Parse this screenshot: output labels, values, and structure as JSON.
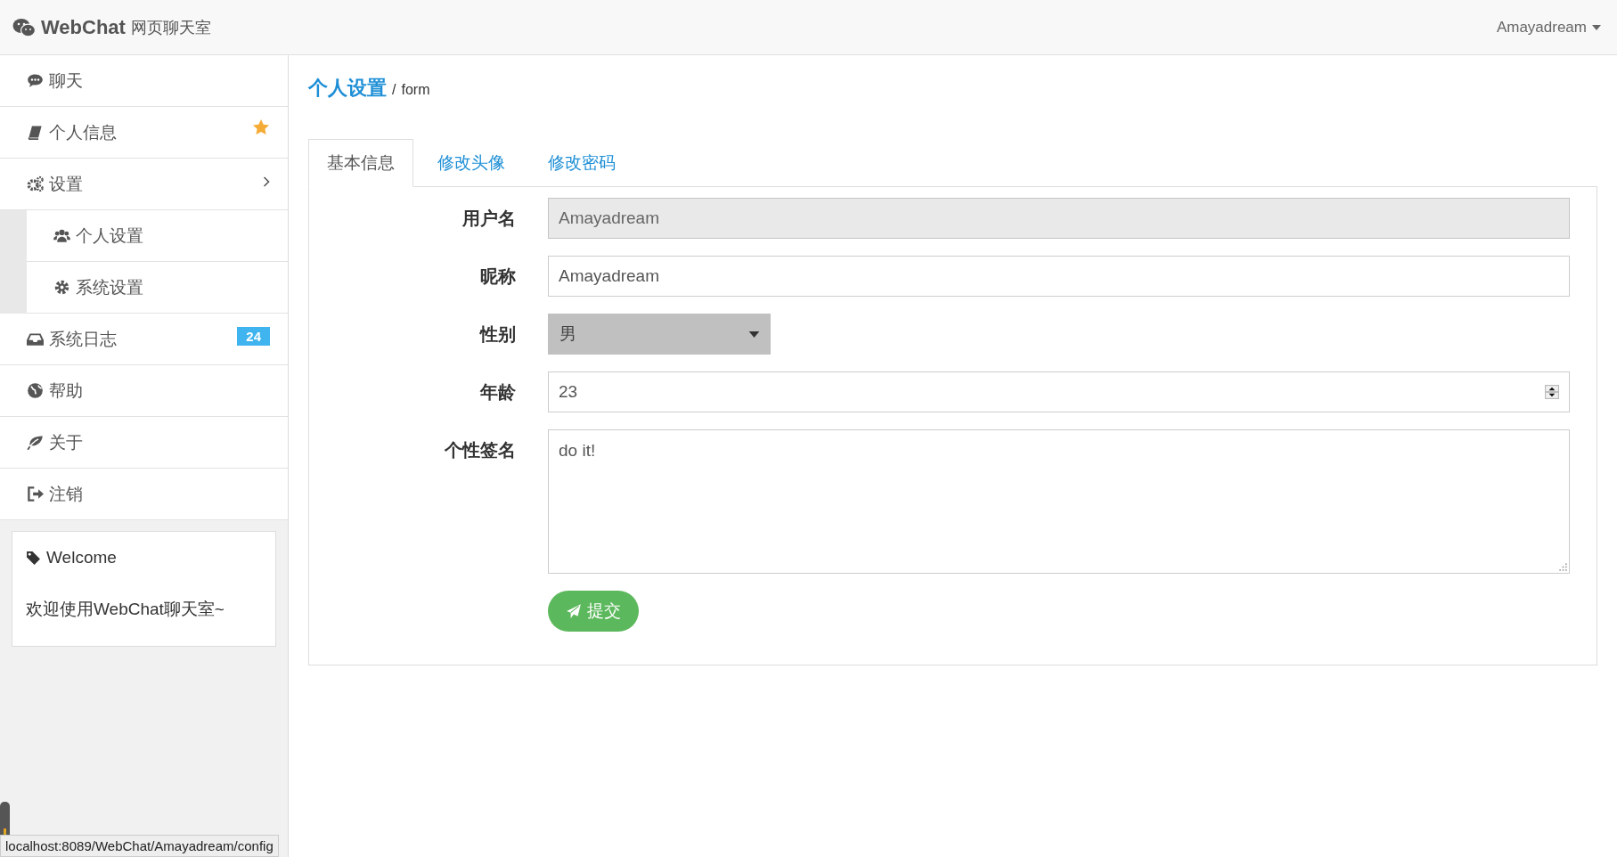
{
  "header": {
    "brand": "WebChat",
    "subtitle": "网页聊天室",
    "user": "Amayadream"
  },
  "sidebar": {
    "items": [
      {
        "label": "聊天"
      },
      {
        "label": "个人信息",
        "starred": true
      },
      {
        "label": "设置",
        "expanded": true,
        "children": [
          {
            "label": "个人设置"
          },
          {
            "label": "系统设置"
          }
        ]
      },
      {
        "label": "系统日志",
        "badge": "24"
      },
      {
        "label": "帮助"
      },
      {
        "label": "关于"
      },
      {
        "label": "注销"
      }
    ],
    "welcome": {
      "title": "Welcome",
      "text": "欢迎使用WebChat聊天室~"
    }
  },
  "breadcrumb": {
    "title": "个人设置",
    "separator": "/",
    "sub": "form"
  },
  "tabs": [
    {
      "label": "基本信息",
      "selected": true
    },
    {
      "label": "修改头像",
      "selected": false
    },
    {
      "label": "修改密码",
      "selected": false
    }
  ],
  "form": {
    "fields": [
      {
        "kind": "text",
        "label": "用户名",
        "value": "Amayadream",
        "disabled": true
      },
      {
        "kind": "text",
        "label": "昵称",
        "value": "Amayadream",
        "disabled": false
      },
      {
        "kind": "select",
        "label": "性别",
        "value": "男"
      },
      {
        "kind": "number",
        "label": "年龄",
        "value": "23"
      },
      {
        "kind": "textarea",
        "label": "个性签名",
        "value": "do it!"
      }
    ],
    "submit": "提交"
  },
  "status_bar": "localhost:8089/WebChat/Amayadream/config"
}
